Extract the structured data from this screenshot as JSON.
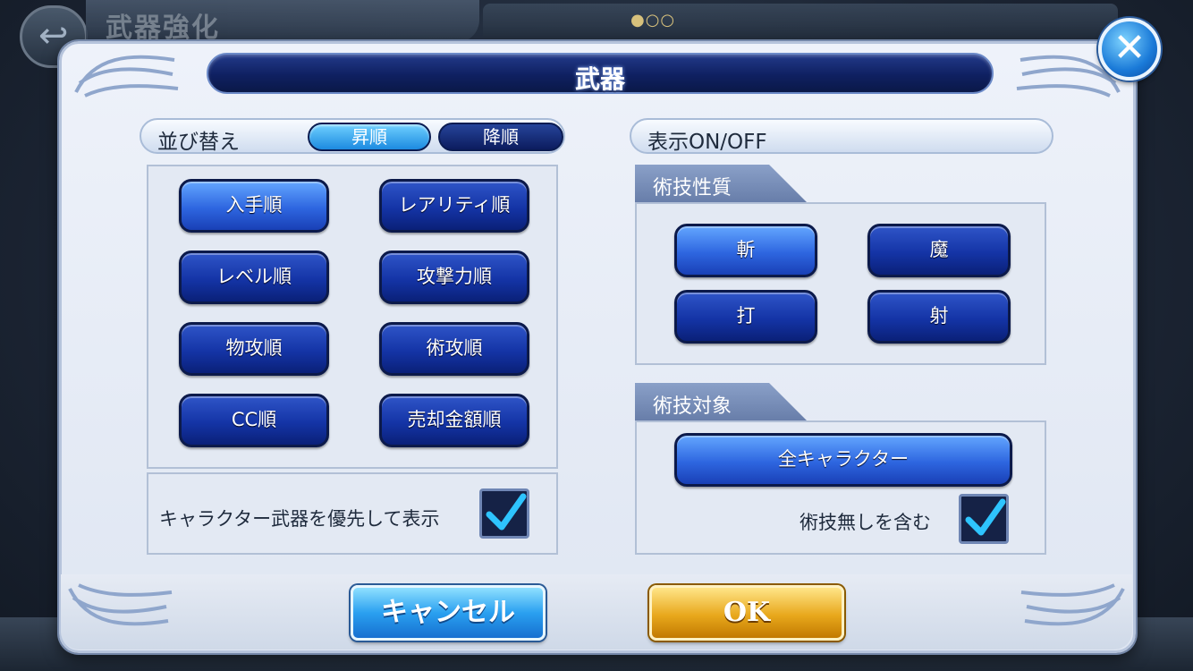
{
  "background": {
    "screen_title": "武器強化",
    "dots": "●○○"
  },
  "dialog": {
    "title": "武器",
    "close_glyph": "✕"
  },
  "sort": {
    "header": "並び替え",
    "asc_label": "昇順",
    "desc_label": "降順",
    "options": [
      "入手順",
      "レアリティ順",
      "レベル順",
      "攻撃力順",
      "物攻順",
      "術攻順",
      "CC順",
      "売却金額順"
    ],
    "priority_label": "キャラクター武器を優先して表示",
    "priority_checked": true
  },
  "display": {
    "header": "表示ON/OFF",
    "attribute": {
      "tab": "術技性質",
      "options": [
        "斬",
        "魔",
        "打",
        "射"
      ]
    },
    "target": {
      "tab": "術技対象",
      "button": "全キャラクター",
      "include_label": "術技無しを含む",
      "include_checked": true
    }
  },
  "footer": {
    "cancel_label": "キャンセル",
    "ok_label": "OK"
  },
  "colors": {
    "dialog_bg": "#e6ebf4",
    "button_blue": "#1434a6",
    "check_color": "#2ec4ff",
    "ok_gold": "#e8a81c",
    "cancel_blue": "#2aa0f0"
  }
}
